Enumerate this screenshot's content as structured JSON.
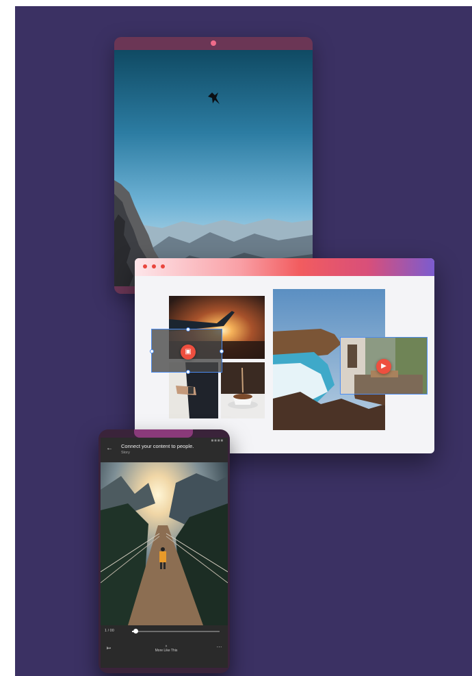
{
  "colors": {
    "canvas": "#3b3163",
    "tablet_frame": "#6b3655",
    "accent_red": "#ee4f3f",
    "selection_blue": "#4c8cf0"
  },
  "browser": {
    "window_buttons": [
      "close",
      "minimize",
      "maximize"
    ],
    "crop_icon": "crop-icon",
    "play_icon": "play-icon"
  },
  "phone": {
    "title": "Connect your content to people.",
    "subtitle": "Story",
    "back_icon": "arrow-left-icon",
    "player": {
      "time": "1 / 00",
      "progress": 0.04,
      "share_icon": "share-icon",
      "more_like_this_label": "More Like This",
      "more_icon": "more-horizontal-icon"
    }
  }
}
